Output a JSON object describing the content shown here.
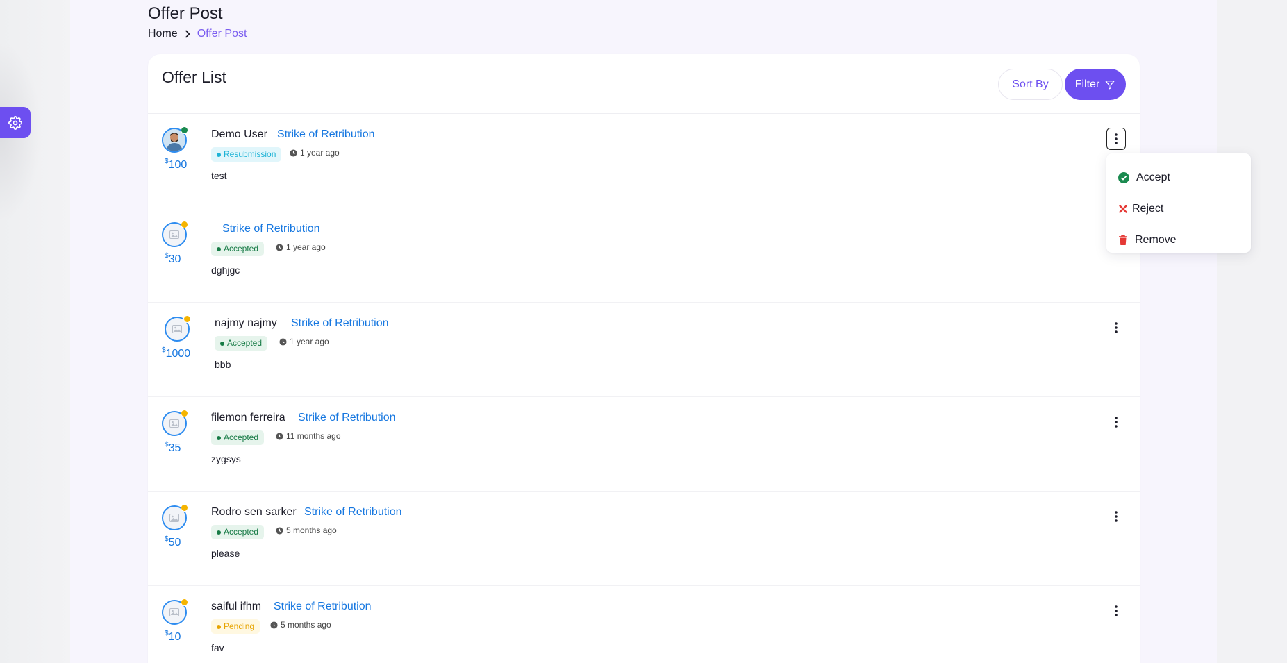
{
  "page": {
    "title": "Offer Post",
    "breadcrumb": {
      "home": "Home",
      "current": "Offer Post"
    }
  },
  "card": {
    "title": "Offer List",
    "sort_label": "Sort By",
    "filter_label": "Filter"
  },
  "dropdown": {
    "accept": "Accept",
    "reject": "Reject",
    "remove": "Remove"
  },
  "offers": [
    {
      "name": "Demo User",
      "post": "Strike of Retribution",
      "status": "Resubmission",
      "time": "1 year ago",
      "message": "test",
      "currency": "$",
      "amount": "100",
      "online": "green",
      "avatar": "photo"
    },
    {
      "name": "",
      "post": "Strike of Retribution",
      "status": "Accepted",
      "time": "1 year ago",
      "message": "dghjgc",
      "currency": "$",
      "amount": "30",
      "online": "yellow",
      "avatar": "placeholder"
    },
    {
      "name": "najmy najmy",
      "post": "Strike of Retribution",
      "status": "Accepted",
      "time": "1 year ago",
      "message": "bbb",
      "currency": "$",
      "amount": "1000",
      "online": "yellow",
      "avatar": "placeholder"
    },
    {
      "name": "filemon ferreira",
      "post": "Strike of Retribution",
      "status": "Accepted",
      "time": "11 months ago",
      "message": "zygsys",
      "currency": "$",
      "amount": "35",
      "online": "yellow",
      "avatar": "placeholder"
    },
    {
      "name": "Rodro sen sarker",
      "post": "Strike of Retribution",
      "status": "Accepted",
      "time": "5 months ago",
      "message": "please",
      "currency": "$",
      "amount": "50",
      "online": "yellow",
      "avatar": "placeholder"
    },
    {
      "name": "saiful ifhm",
      "post": "Strike of Retribution",
      "status": "Pending",
      "time": "5 months ago",
      "message": "fav",
      "currency": "$",
      "amount": "10",
      "online": "yellow",
      "avatar": "placeholder"
    }
  ],
  "colors": {
    "accent": "#6d4ff0",
    "link": "#1677e0",
    "online_green": "#1a8a4f",
    "online_yellow": "#f5b400",
    "reject_red": "#e53935",
    "remove_red": "#e53935"
  }
}
